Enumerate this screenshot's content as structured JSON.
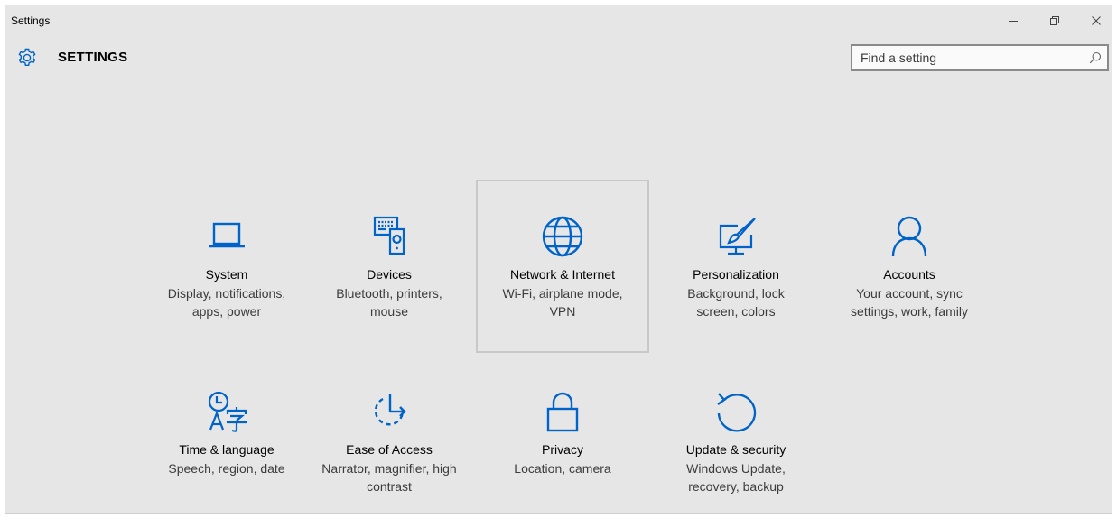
{
  "window": {
    "title": "Settings"
  },
  "header": {
    "title": "SETTINGS",
    "gear_icon": "gear-icon"
  },
  "search": {
    "placeholder": "Find a setting",
    "value": "",
    "icon": "search-icon"
  },
  "controls": {
    "minimize_icon": "minimize-icon",
    "restore_icon": "restore-icon",
    "close_icon": "close-icon"
  },
  "colors": {
    "accent": "#0063c9",
    "background": "#e6e6e6",
    "description": "#3c3c3c"
  },
  "tiles": [
    {
      "icon": "laptop-icon",
      "label": "System",
      "description": "Display, notifications, apps, power"
    },
    {
      "icon": "devices-icon",
      "label": "Devices",
      "description": "Bluetooth, printers, mouse"
    },
    {
      "icon": "globe-icon",
      "label": "Network & Internet",
      "description": "Wi-Fi, airplane mode, VPN"
    },
    {
      "icon": "personalization-icon",
      "label": "Personalization",
      "description": "Background, lock screen, colors"
    },
    {
      "icon": "person-icon",
      "label": "Accounts",
      "description": "Your account, sync settings, work, family"
    },
    {
      "icon": "time-language-icon",
      "label": "Time & language",
      "description": "Speech, region, date"
    },
    {
      "icon": "ease-of-access-icon",
      "label": "Ease of Access",
      "description": "Narrator, magnifier, high contrast"
    },
    {
      "icon": "lock-icon",
      "label": "Privacy",
      "description": "Location, camera"
    },
    {
      "icon": "update-icon",
      "label": "Update & security",
      "description": "Windows Update, recovery, backup"
    }
  ]
}
